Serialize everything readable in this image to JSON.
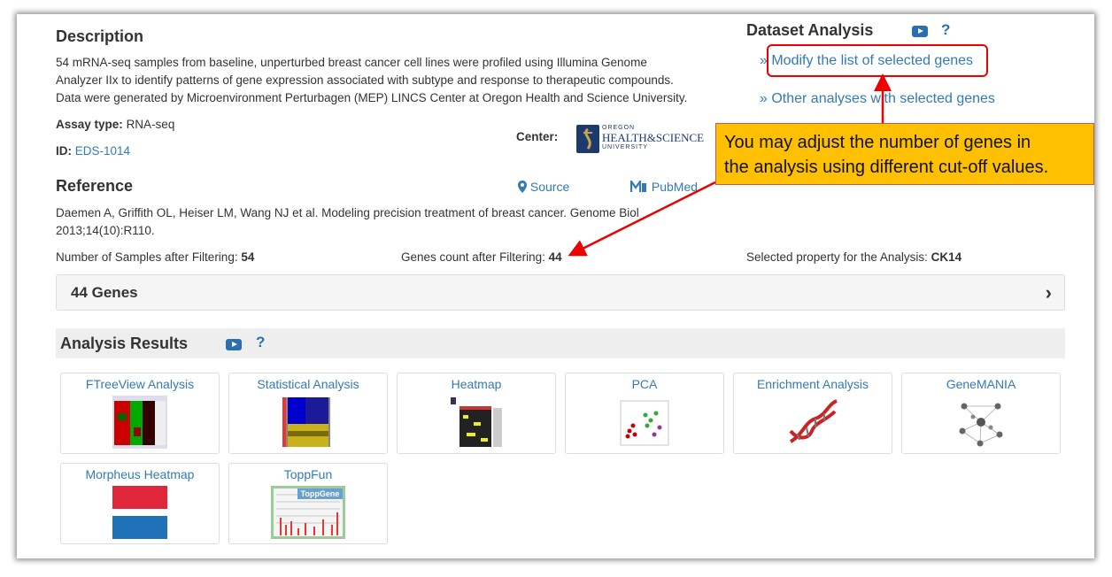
{
  "description": {
    "heading": "Description",
    "line1": "54 mRNA-seq samples from baseline, unperturbed breast cancer cell lines were profiled using Illumina Genome",
    "line2": "Analyzer IIx to identify patterns of gene expression associated with subtype and response to therapeutic compounds.",
    "line3": "Data were generated by Microenvironment Perturbagen (MEP) LINCS Center at Oregon Health and Science University."
  },
  "assay": {
    "label": "Assay type:",
    "value": "RNA-seq"
  },
  "id": {
    "label": "ID:",
    "value": "EDS-1014"
  },
  "center": {
    "label": "Center:",
    "logo_small": "OREGON",
    "logo_main": "HEALTH&SCIENCE",
    "logo_sub": "UNIVERSITY"
  },
  "reference": {
    "heading": "Reference",
    "source": "Source",
    "pubmed": "PubMed",
    "line1": "Daemen A, Griffith OL, Heiser LM, Wang NJ et al. Modeling precision treatment of breast cancer. Genome Biol",
    "line2": "2013;14(10):R110."
  },
  "stats": {
    "samples_label": "Number of Samples after Filtering:",
    "samples_value": "54",
    "genes_label": "Genes count after Filtering:",
    "genes_value": "44",
    "property_label": "Selected property for the Analysis:",
    "property_value": "CK14"
  },
  "dataset_analysis": {
    "heading": "Dataset Analysis",
    "help": "?",
    "modify_link": "» Modify the list of selected genes",
    "other_link": "» Other analyses with selected genes"
  },
  "genes_panel": {
    "title": "44 Genes",
    "chevron": "›"
  },
  "analysis_results": {
    "heading": "Analysis Results",
    "help": "?",
    "tiles": [
      {
        "label": "FTreeView Analysis",
        "icon": "ftreeview-thumbnail"
      },
      {
        "label": "Statistical Analysis",
        "icon": "statistical-thumbnail"
      },
      {
        "label": "Heatmap",
        "icon": "heatmap-thumbnail"
      },
      {
        "label": "PCA",
        "icon": "pca-thumbnail"
      },
      {
        "label": "Enrichment Analysis",
        "icon": "dna-thumbnail"
      },
      {
        "label": "GeneMANIA",
        "icon": "network-thumbnail"
      },
      {
        "label": "Morpheus Heatmap",
        "icon": "morpheus-thumbnail"
      },
      {
        "label": "ToppFun",
        "icon": "toppgene-thumbnail",
        "badge": "ToppGene"
      }
    ]
  },
  "callout": {
    "line1": "You may adjust the number of genes in",
    "line2": "the analysis using different cut-off values."
  },
  "colors": {
    "link": "#337ab7",
    "callout_bg": "#ffc000",
    "annotation_red": "#ee0000"
  }
}
